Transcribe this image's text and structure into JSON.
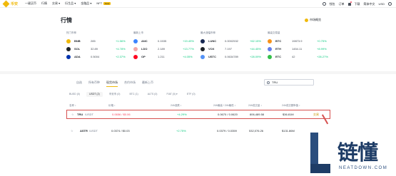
{
  "nav": {
    "logo": "币安",
    "items": [
      "一键买币",
      "行情",
      "交易 ▾",
      "衍生品 ▾",
      "金融品 ▾",
      "NFT"
    ],
    "nft_badge": "New",
    "right": [
      "钱包",
      "订单",
      "下载",
      "简体中文",
      "USD"
    ]
  },
  "header": {
    "title": "行情",
    "announcement": "市场概览"
  },
  "cards": [
    {
      "title": "热门币种",
      "rows": [
        {
          "sym": "BNB",
          "price": "285",
          "chg": "+1.56%",
          "color": "#f0b90b"
        },
        {
          "sym": "SOL",
          "price": "32.89",
          "chg": "+4.78%",
          "color": "#1e2329"
        },
        {
          "sym": "ADA",
          "price": "0.5004",
          "chg": "+2.37%",
          "color": "#0033ad"
        }
      ]
    },
    {
      "title": "最新上币",
      "rows": [
        {
          "sym": "ANC",
          "price": "0.1535",
          "chg": "+19.49%",
          "color": "#3b84ff"
        },
        {
          "sym": "LDO",
          "price": "2.189",
          "chg": "+13.77%",
          "color": "#f4a7a7"
        },
        {
          "sym": "OP",
          "price": "1.211",
          "chg": "+4.05%",
          "color": "#ff0420"
        }
      ]
    },
    {
      "title": "最大涨幅币种",
      "rows": [
        {
          "sym": "LUNC",
          "price": "0.0002532",
          "chg": "+62.15%",
          "color": "#172852"
        },
        {
          "sym": "VOX",
          "price": "7.197",
          "chg": "+44.45%",
          "color": "#1e2329"
        },
        {
          "sym": "USTC",
          "price": "0.0634789",
          "chg": "+28.09%",
          "color": "#5493f7"
        }
      ]
    },
    {
      "title": "最高交易量",
      "rows": [
        {
          "sym": "BTC",
          "price": "19873.9",
          "chg": "+0.75%",
          "color": "#f7931a"
        },
        {
          "sym": "ETH",
          "price": "1454.11",
          "chg": "+8.99%",
          "color": "#627eea"
        },
        {
          "sym": "ETC",
          "price": "42",
          "chg": "+26.27%",
          "color": "#33bf4a"
        }
      ]
    }
  ],
  "tabs": [
    "自选",
    "所有币种",
    "现货市场",
    "合约市场",
    "最新上币"
  ],
  "search": {
    "value": "TRU"
  },
  "subtabs": [
    "BUSD (0)",
    "USDT (2)",
    "币安币 (0)",
    "BTC (1)",
    "ALTS (0)",
    "FIAT (0) ▾",
    "ETF (0)"
  ],
  "table": {
    "headers": [
      "名称 ↕",
      "价格 ↕",
      "24h涨跌 ↕",
      "24h最高 / 24h最低 ↕",
      "24h成交量 ↕",
      "24h成交额 ↕",
      "市值 ↕"
    ],
    "rows": [
      {
        "star": "☆",
        "base": "TRU",
        "quote": "/USDT",
        "price": "0.0656 / $0.06",
        "change": "+4.29%",
        "hilo": "0.0670 / 0.0620",
        "volume": "806,489.58",
        "cap": "$36.81M",
        "action": "交易"
      },
      {
        "star": "☆",
        "base": "ASTR",
        "quote": "/USDT",
        "price": "0.0374 / $0.03",
        "change": "+2.75%",
        "hilo": "0.0379 / 0.0359",
        "volume": "532,076.26",
        "cap": "$131.86M",
        "action": ""
      }
    ]
  },
  "watermark": {
    "title": "链懂",
    "sub": "NEATDOWN.COM"
  }
}
